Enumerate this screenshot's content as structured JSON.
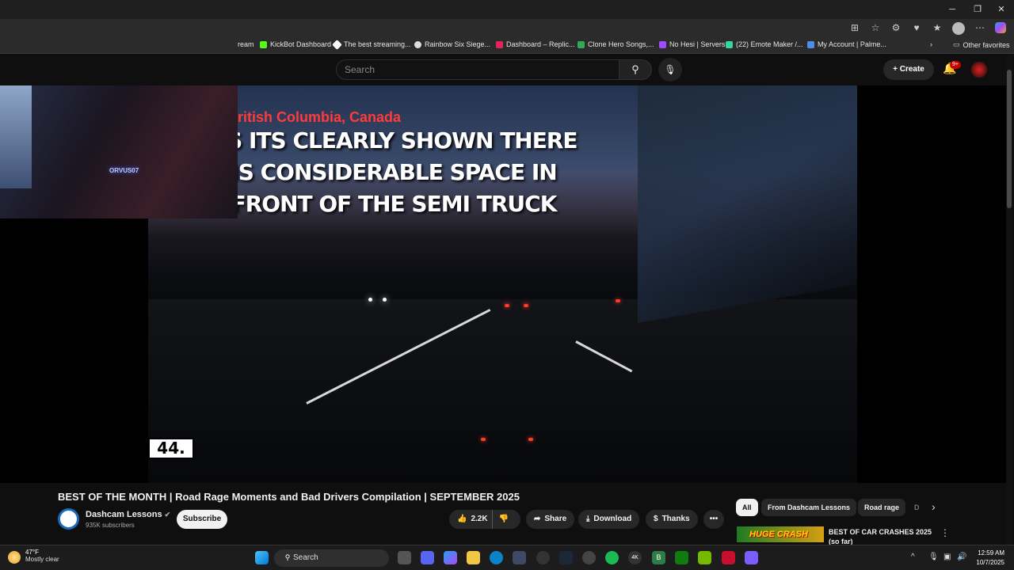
{
  "window": {
    "minimize": "─",
    "maximize": "❐",
    "close": "✕"
  },
  "bookmarks": [
    {
      "label": "ream",
      "color": "#888"
    },
    {
      "label": "KickBot Dashboard",
      "color": "#53fc18"
    },
    {
      "label": "The best streaming...",
      "color": "#ffffff"
    },
    {
      "label": "Rainbow Six Siege...",
      "color": "#dddddd"
    },
    {
      "label": "Dashboard – Replic...",
      "color": "#e0245e"
    },
    {
      "label": "Clone Hero Songs,...",
      "color": "#34a853"
    },
    {
      "label": "No Hesi | Servers",
      "color": "#9b4dff"
    },
    {
      "label": "(22) Emote Maker /...",
      "color": "#3ad29f"
    },
    {
      "label": "My Account | Palme...",
      "color": "#4a90e2"
    }
  ],
  "other_favorites": "Other favorites",
  "header": {
    "search_placeholder": "Search",
    "create_label": "Create",
    "notifications_badge": "9+"
  },
  "video": {
    "location": "ritish Columbia, Canada",
    "caption": "AS ITS CLEARLY SHOWN THERE IS CONSIDERABLE SPACE IN FRONT OF THE SEMI TRUCK",
    "counter": "44."
  },
  "webcam": {
    "neon_text": "ORVUS07"
  },
  "details": {
    "title": "BEST OF THE MONTH | Road Rage Moments and Bad Drivers Compilation | SEPTEMBER 2025",
    "channel_name": "Dashcam Lessons",
    "verified": "✔",
    "subscribers": "935K subscribers",
    "subscribe_label": "Subscribe",
    "likes": "2.2K",
    "share_label": "Share",
    "download_label": "Download",
    "thanks_label": "Thanks",
    "more_label": "•••"
  },
  "chips": [
    "All",
    "From Dashcam Lessons",
    "Road rage",
    "D"
  ],
  "recommended": {
    "thumb_text": "HUGE CRASH",
    "title": "BEST OF CAR CRASHES 2025 (so far)"
  },
  "taskbar": {
    "temperature": "47°F",
    "weather": "Mostly clear",
    "search_label": "Search",
    "time": "12:59 AM",
    "date": "10/7/2025"
  }
}
